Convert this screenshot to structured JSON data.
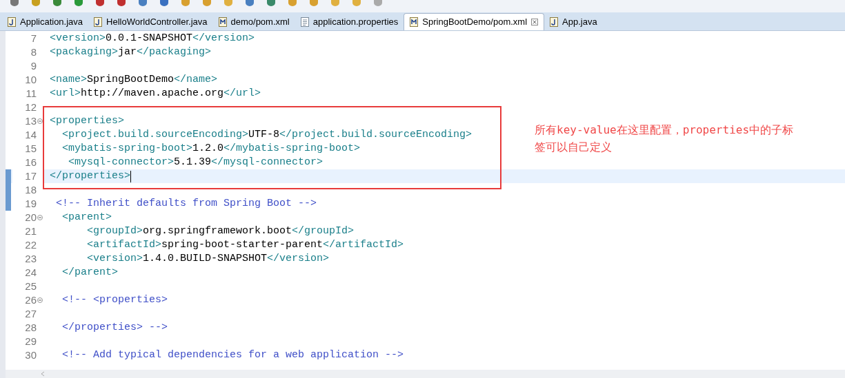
{
  "tabs": [
    {
      "label": "Application.java",
      "kind": "java",
      "selected": false,
      "closable": false
    },
    {
      "label": "HelloWorldController.java",
      "kind": "java",
      "selected": false,
      "closable": false
    },
    {
      "label": "demo/pom.xml",
      "kind": "maven",
      "selected": false,
      "closable": false
    },
    {
      "label": "application.properties",
      "kind": "file",
      "selected": false,
      "closable": false
    },
    {
      "label": "SpringBootDemo/pom.xml",
      "kind": "maven",
      "selected": true,
      "closable": true
    },
    {
      "label": "App.java",
      "kind": "java",
      "selected": false,
      "closable": false
    }
  ],
  "editor": {
    "lines": [
      {
        "number": "7",
        "fold": false,
        "current": false,
        "changed": false,
        "segments": [
          {
            "kind": "tag",
            "text": "<version>"
          },
          {
            "kind": "text",
            "text": "0.0.1-SNAPSHOT"
          },
          {
            "kind": "tag",
            "text": "</version>"
          }
        ]
      },
      {
        "number": "8",
        "fold": false,
        "current": false,
        "changed": false,
        "segments": [
          {
            "kind": "tag",
            "text": "<packaging>"
          },
          {
            "kind": "text",
            "text": "jar"
          },
          {
            "kind": "tag",
            "text": "</packaging>"
          }
        ]
      },
      {
        "number": "9",
        "fold": false,
        "current": false,
        "changed": false
      },
      {
        "number": "10",
        "fold": false,
        "current": false,
        "changed": false,
        "segments": [
          {
            "kind": "tag",
            "text": "<name>"
          },
          {
            "kind": "text",
            "text": "SpringBootDemo"
          },
          {
            "kind": "tag",
            "text": "</name>"
          }
        ]
      },
      {
        "number": "11",
        "fold": false,
        "current": false,
        "changed": false,
        "segments": [
          {
            "kind": "tag",
            "text": "<url>"
          },
          {
            "kind": "text",
            "text": "http://maven.apache.org"
          },
          {
            "kind": "tag",
            "text": "</url>"
          }
        ]
      },
      {
        "number": "12",
        "fold": false,
        "current": false,
        "changed": false
      },
      {
        "number": "13",
        "fold": true,
        "current": false,
        "changed": false,
        "segments": [
          {
            "kind": "tag",
            "text": "<properties>"
          }
        ]
      },
      {
        "number": "14",
        "fold": false,
        "current": false,
        "changed": false,
        "segments": [
          {
            "kind": "tag",
            "text": "  <project.build.sourceEncoding>"
          },
          {
            "kind": "text",
            "text": "UTF-8"
          },
          {
            "kind": "tag",
            "text": "</project.build.sourceEncoding>"
          }
        ]
      },
      {
        "number": "15",
        "fold": false,
        "current": false,
        "changed": false,
        "segments": [
          {
            "kind": "tag",
            "text": "  <mybatis-spring-boot>"
          },
          {
            "kind": "text",
            "text": "1.2.0"
          },
          {
            "kind": "tag",
            "text": "</mybatis-spring-boot>"
          }
        ]
      },
      {
        "number": "16",
        "fold": false,
        "current": false,
        "changed": false,
        "segments": [
          {
            "kind": "tag",
            "text": "   <mysql-connector>"
          },
          {
            "kind": "text",
            "text": "5.1.39"
          },
          {
            "kind": "tag",
            "text": "</mysql-connector>"
          }
        ]
      },
      {
        "number": "17",
        "fold": false,
        "current": true,
        "changed": true,
        "segments": [
          {
            "kind": "tag",
            "text": "</properties>"
          }
        ]
      },
      {
        "number": "18",
        "fold": false,
        "current": false,
        "changed": true
      },
      {
        "number": "19",
        "fold": false,
        "current": false,
        "changed": true,
        "segments": [
          {
            "kind": "comment",
            "text": " <!-- Inherit defaults from Spring Boot -->"
          }
        ]
      },
      {
        "number": "20",
        "fold": true,
        "current": false,
        "changed": false,
        "segments": [
          {
            "kind": "tag",
            "text": "  <parent>"
          }
        ]
      },
      {
        "number": "21",
        "fold": false,
        "current": false,
        "changed": false,
        "segments": [
          {
            "kind": "tag",
            "text": "      <groupId>"
          },
          {
            "kind": "text",
            "text": "org.springframework.boot"
          },
          {
            "kind": "tag",
            "text": "</groupId>"
          }
        ]
      },
      {
        "number": "22",
        "fold": false,
        "current": false,
        "changed": false,
        "segments": [
          {
            "kind": "tag",
            "text": "      <artifactId>"
          },
          {
            "kind": "text",
            "text": "spring-boot-starter-parent"
          },
          {
            "kind": "tag",
            "text": "</artifactId>"
          }
        ]
      },
      {
        "number": "23",
        "fold": false,
        "current": false,
        "changed": false,
        "segments": [
          {
            "kind": "tag",
            "text": "      <version>"
          },
          {
            "kind": "text",
            "text": "1.4.0.BUILD-SNAPSHOT"
          },
          {
            "kind": "tag",
            "text": "</version>"
          }
        ]
      },
      {
        "number": "24",
        "fold": false,
        "current": false,
        "changed": false,
        "segments": [
          {
            "kind": "tag",
            "text": "  </parent>"
          }
        ]
      },
      {
        "number": "25",
        "fold": false,
        "current": false,
        "changed": false
      },
      {
        "number": "26",
        "fold": true,
        "current": false,
        "changed": false,
        "segments": [
          {
            "kind": "comment",
            "text": "  <!-- <properties>"
          }
        ]
      },
      {
        "number": "27",
        "fold": false,
        "current": false,
        "changed": false
      },
      {
        "number": "28",
        "fold": false,
        "current": false,
        "changed": false,
        "segments": [
          {
            "kind": "comment",
            "text": "  </properties> -->"
          }
        ]
      },
      {
        "number": "29",
        "fold": false,
        "current": false,
        "changed": false
      },
      {
        "number": "30",
        "fold": false,
        "current": false,
        "changed": false,
        "segments": [
          {
            "kind": "comment",
            "text": "  <!-- Add typical dependencies for a web application -->"
          }
        ]
      }
    ],
    "annotation": {
      "text": "所有key-value在这里配置，properties中的子标签可以自己定义"
    }
  }
}
